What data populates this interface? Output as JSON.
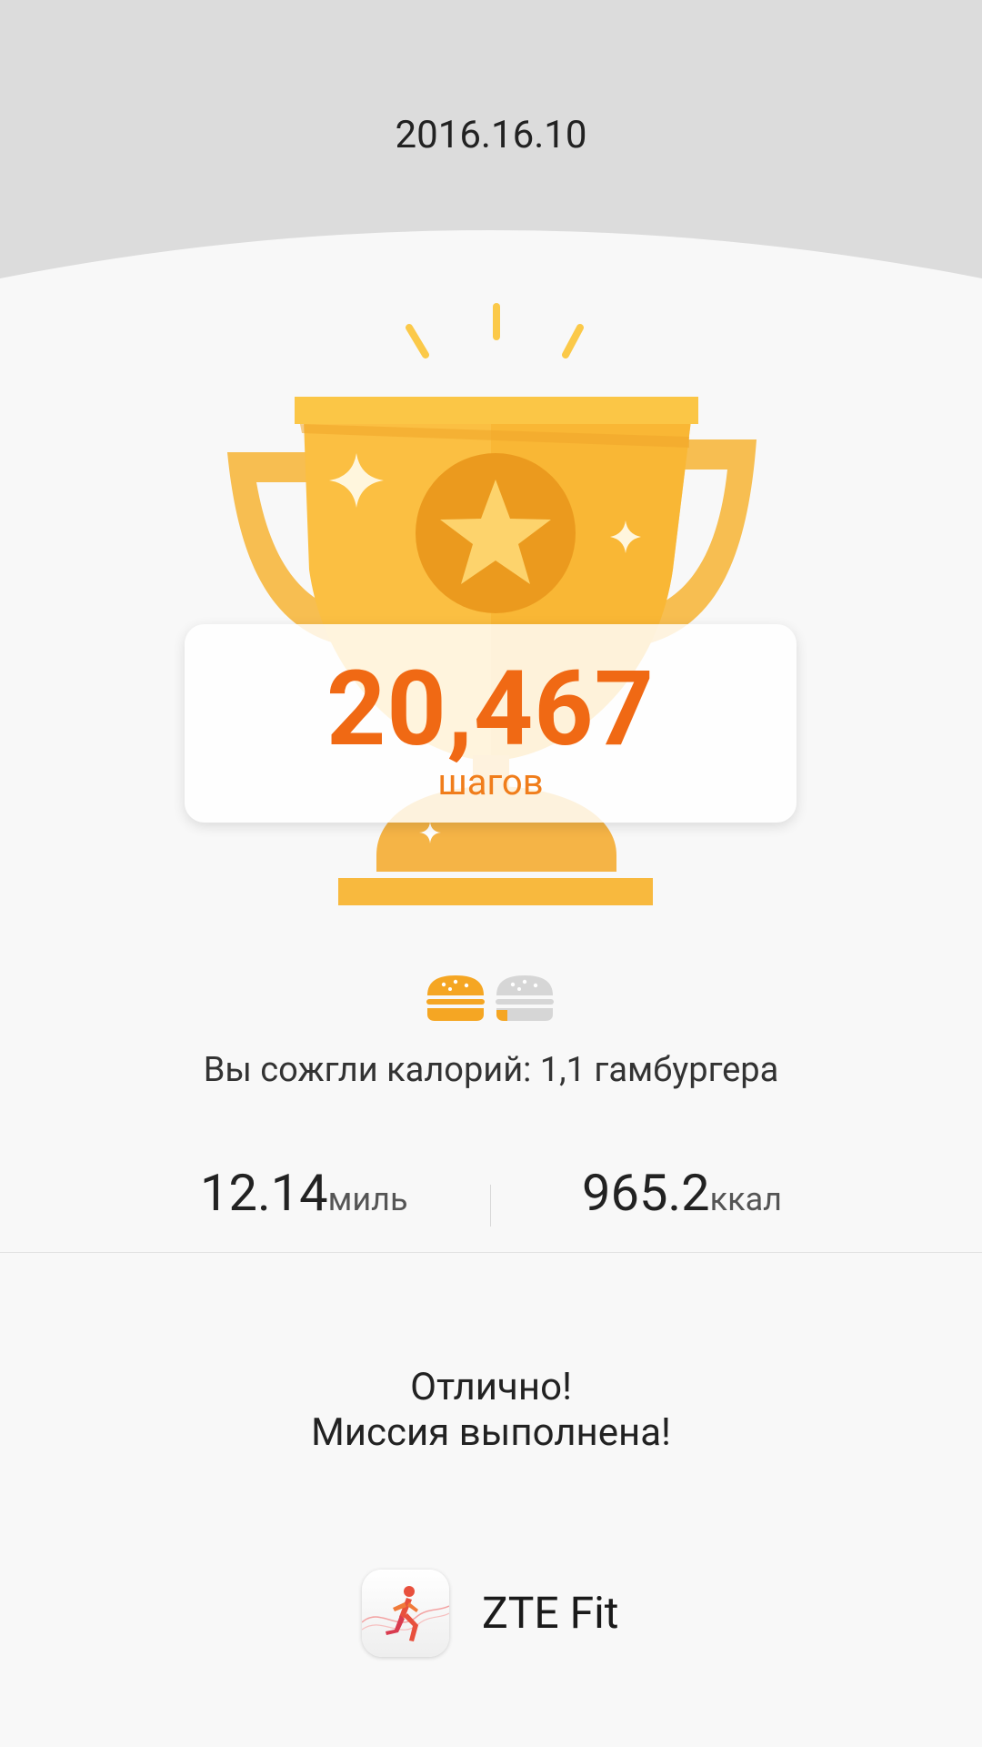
{
  "header": {
    "date": "2016.16.10"
  },
  "achievement": {
    "steps_value": "20,467",
    "steps_unit": "шагов"
  },
  "calories_burned": {
    "text": "Вы сожгли калорий: 1,1 гамбургера",
    "burger_count": 1.1
  },
  "stats": {
    "distance_value": "12.14",
    "distance_unit": "миль",
    "calories_value": "965.2",
    "calories_unit": "ккал"
  },
  "message": {
    "line1": "Отлично!",
    "line2": "Миссия выполнена!"
  },
  "app": {
    "name": "ZTE Fit",
    "icon": "running-person-icon"
  },
  "colors": {
    "accent": "#f06914",
    "trophy": "#fbbf42",
    "header_bg": "#dcdcdc",
    "page_bg": "#f8f8f8"
  }
}
